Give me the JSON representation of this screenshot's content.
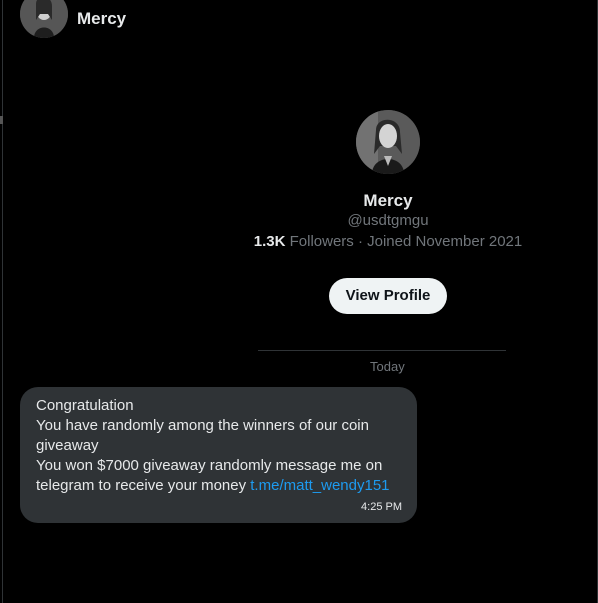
{
  "header": {
    "name": "Mercy"
  },
  "profile": {
    "name": "Mercy",
    "handle": "@usdtgmgu",
    "followers_count": "1.3K",
    "followers_rest": " Followers · Joined November 2021",
    "view_button": "View Profile"
  },
  "conversation": {
    "day_label": "Today",
    "message": {
      "line1": "Congratulation",
      "line2": "You have randomly among the winners of our coin",
      "line3": "giveaway",
      "line4": "You won $7000 giveaway randomly message me on",
      "line5": "telegram to receive your money ",
      "link": "t.me/matt_wendy151",
      "time": "4:25 PM"
    }
  },
  "colors": {
    "background": "#000000",
    "bubble": "#2f3336",
    "link": "#1d9bf0",
    "muted": "#71767b"
  },
  "icons": {
    "header_avatar": "avatar-photo",
    "profile_avatar": "avatar-photo"
  }
}
